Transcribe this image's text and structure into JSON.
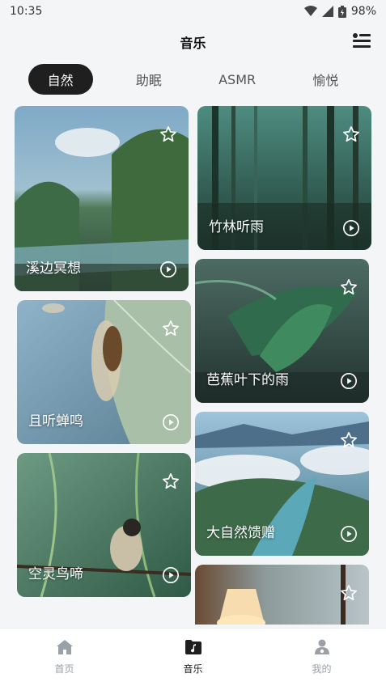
{
  "status_bar": {
    "time": "10:35",
    "battery": "98%"
  },
  "header": {
    "title": "音乐"
  },
  "tabs": [
    {
      "label": "自然",
      "active": true
    },
    {
      "label": "助眠",
      "active": false
    },
    {
      "label": "ASMR",
      "active": false
    },
    {
      "label": "愉悦",
      "active": false
    }
  ],
  "cards": [
    {
      "title": "溪边冥想"
    },
    {
      "title": "竹林听雨"
    },
    {
      "title": "且听蝉鸣"
    },
    {
      "title": "芭蕉叶下的雨"
    },
    {
      "title": "空灵鸟啼"
    },
    {
      "title": "大自然馈赠"
    },
    {
      "title": ""
    }
  ],
  "bottom_nav": [
    {
      "label": "首页",
      "icon": "home-icon",
      "active": false
    },
    {
      "label": "音乐",
      "icon": "music-folder-icon",
      "active": true
    },
    {
      "label": "我的",
      "icon": "profile-icon",
      "active": false
    }
  ],
  "colors": {
    "accent": "#1f1f1f",
    "inactive": "#9aa0a6",
    "background": "#f4f5f7"
  }
}
